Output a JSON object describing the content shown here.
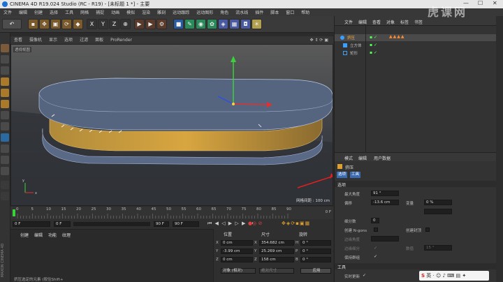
{
  "titlebar": {
    "title": "CINEMA 4D R19.024 Studio (RC - R19) - [未标题 1 *] - 主要",
    "minimize": "—",
    "maximize": "☐",
    "close": "✕"
  },
  "menu": [
    "文件",
    "编辑",
    "创建",
    "选择",
    "工具",
    "网格",
    "捕捉",
    "动画",
    "模拟",
    "渲染",
    "雕刻",
    "运动跟踪",
    "运动图形",
    "角色",
    "流水线",
    "插件",
    "脚本",
    "窗口",
    "帮助"
  ],
  "toolbar": {
    "undo": "↶",
    "axis_x": "X",
    "axis_y": "Y",
    "axis_z": "Z"
  },
  "viewport": {
    "menu": [
      "查看",
      "摄像机",
      "显示",
      "选项",
      "过滤",
      "面板",
      "ProRender"
    ],
    "label": "透视视图",
    "grid_spacing": "网格间距 : 100 cm"
  },
  "timeline": {
    "ticks": [
      "0",
      "5",
      "10",
      "15",
      "20",
      "25",
      "30",
      "35",
      "40",
      "45",
      "50",
      "55",
      "60",
      "65",
      "70",
      "75",
      "80",
      "85",
      "90"
    ],
    "end_label": "0 F"
  },
  "transport": {
    "start": "0 F",
    "current": "0 F",
    "end": "90 F",
    "end2": "90 F"
  },
  "material": {
    "menu": [
      "创建",
      "编辑",
      "功能",
      "纹理"
    ],
    "side_label": "MAXON CINEMA 4D"
  },
  "coords": {
    "headers": {
      "position": "位置",
      "size": "尺寸",
      "rotation": "旋转"
    },
    "rows": [
      {
        "axis": "X",
        "pos": "0 cm",
        "size_axis": "X",
        "size": "354.682 cm",
        "rot_axis": "H",
        "rot": "0 °"
      },
      {
        "axis": "Y",
        "pos": "-3.99 cm",
        "size_axis": "Y",
        "size": "25.269 cm",
        "rot_axis": "P",
        "rot": "0 °"
      },
      {
        "axis": "Z",
        "pos": "0 cm",
        "size_axis": "Z",
        "size": "158 cm",
        "rot_axis": "B",
        "rot": "0 °"
      }
    ],
    "mode": "对象 (相对)",
    "size_mode": "绝对尺寸",
    "apply": "应用"
  },
  "objects": {
    "menu": [
      "文件",
      "编辑",
      "查看",
      "对象",
      "标签",
      "书签"
    ],
    "items": [
      {
        "name": "挤压",
        "color": "#3aa0ff"
      },
      {
        "name": "立方体",
        "color": "#3aa0ff"
      },
      {
        "name": "矩形",
        "color": "#3aa0ff"
      }
    ]
  },
  "attributes": {
    "menu": [
      "模式",
      "编辑",
      "用户数据"
    ],
    "object_name": "挤压",
    "tabs": [
      "选项",
      "工具"
    ],
    "section1": "选项",
    "fields": [
      {
        "label": "最大角度",
        "value": "91 °"
      },
      {
        "label": "偏移",
        "value": "-13.6 cm"
      },
      {
        "label": "变量",
        "value": "0 %"
      },
      {
        "label": "细分数",
        "value": "0"
      },
      {
        "label": "创建 N-gons",
        "value": ""
      },
      {
        "label": "创建封顶",
        "value": ""
      },
      {
        "label": "边缘角度",
        "value": ""
      },
      {
        "label": "边缘细分",
        "value": ""
      },
      {
        "label": "保持群组",
        "value": ""
      }
    ],
    "section2": "工具",
    "realtime": "实时更新"
  },
  "watermark": "虎课网",
  "statusbar": "挤压选定的元素 (按住Shift+"
}
